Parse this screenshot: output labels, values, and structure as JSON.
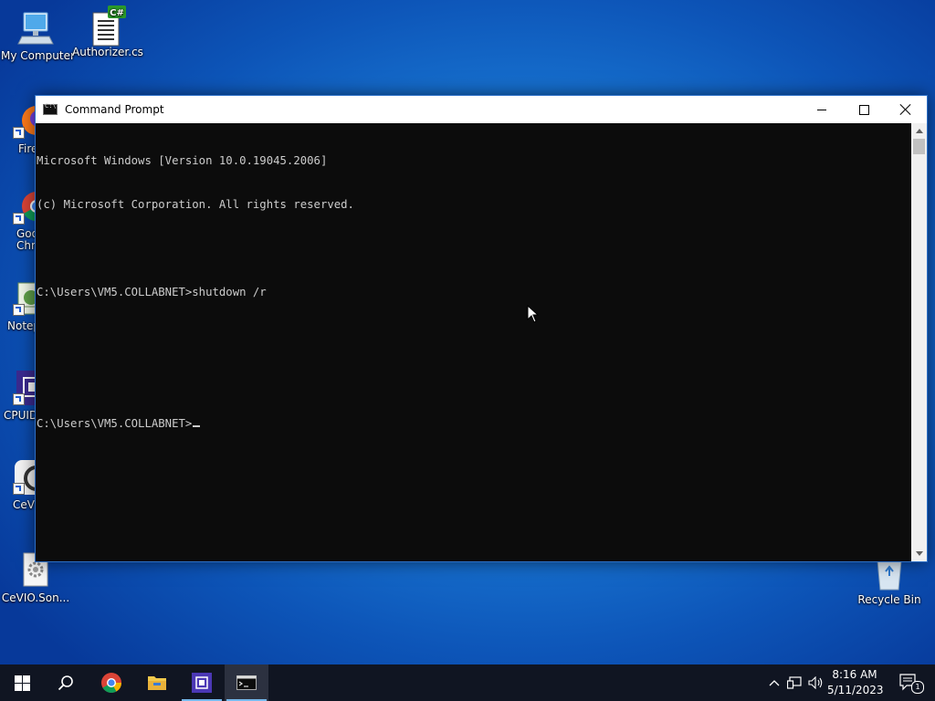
{
  "desktop": {
    "icons": [
      {
        "label": "My Computer",
        "icon": "computer-icon"
      },
      {
        "label": "Authorizer.cs",
        "icon": "csharp-file-icon",
        "badge": "C#"
      },
      {
        "label": "Fire",
        "icon": "firefox-icon"
      },
      {
        "label": "Goo Chro",
        "icon": "chrome-icon"
      },
      {
        "label": "Notep",
        "icon": "notepad-icon"
      },
      {
        "label": "CPUID",
        "icon": "cpuid-icon"
      },
      {
        "label": "CeVI",
        "icon": "cevio-icon"
      },
      {
        "label": "CeVIO.Son...",
        "icon": "settings-file-icon"
      },
      {
        "label": "Recycle Bin",
        "icon": "recycle-bin-icon"
      }
    ]
  },
  "window": {
    "title": "Command Prompt",
    "icon": "cmd-icon",
    "controls": [
      "minimize",
      "maximize",
      "close"
    ]
  },
  "console": {
    "lines": [
      "Microsoft Windows [Version 10.0.19045.2006]",
      "(c) Microsoft Corporation. All rights reserved.",
      "",
      "C:\\Users\\VM5.COLLABNET>shutdown /r",
      "",
      "",
      "C:\\Users\\VM5.COLLABNET>"
    ]
  },
  "taskbar": {
    "items": [
      "start-icon",
      "search-icon",
      "chrome-icon",
      "file-explorer-icon",
      "cpuid-icon",
      "cmd-icon"
    ],
    "active": "cmd-icon"
  },
  "tray": {
    "time": "8:16 AM",
    "date": "5/11/2023",
    "notification_count": "1"
  },
  "colors": {
    "console_bg": "#0c0c0c",
    "console_fg": "#cccccc",
    "taskbar_bg": "#101522",
    "accent": "#76b9ed"
  }
}
